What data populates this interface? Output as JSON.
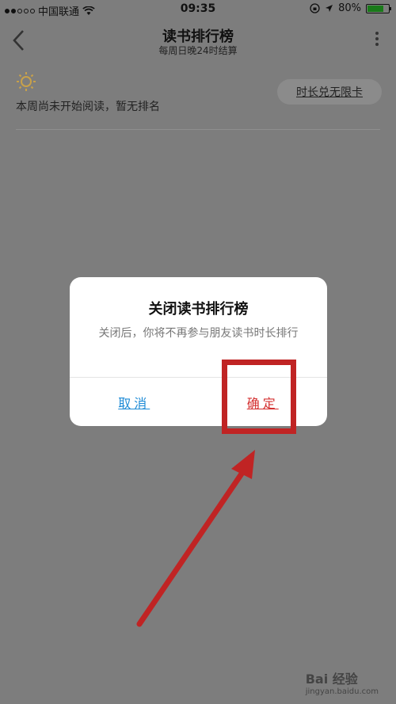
{
  "status": {
    "carrier": "中国联通",
    "time": "09:35",
    "battery": "80%",
    "battery_level": 0.8
  },
  "nav": {
    "title": "读书排行榜",
    "subtitle": "每周日晚24时结算"
  },
  "page": {
    "empty_text": "本周尚未开始阅读，暂无排名",
    "card_button": "时长兑无限卡"
  },
  "dialog": {
    "title": "关闭读书排行榜",
    "message": "关闭后，你将不再参与朋友读书时长排行",
    "cancel": "取消",
    "confirm": "确定"
  },
  "watermark": {
    "brand": "Bai 经验",
    "url": "jingyan.baidu.com"
  },
  "colors": {
    "annotation": "#c02424",
    "cancel": "#1e8bd6",
    "confirm": "#d43030"
  }
}
